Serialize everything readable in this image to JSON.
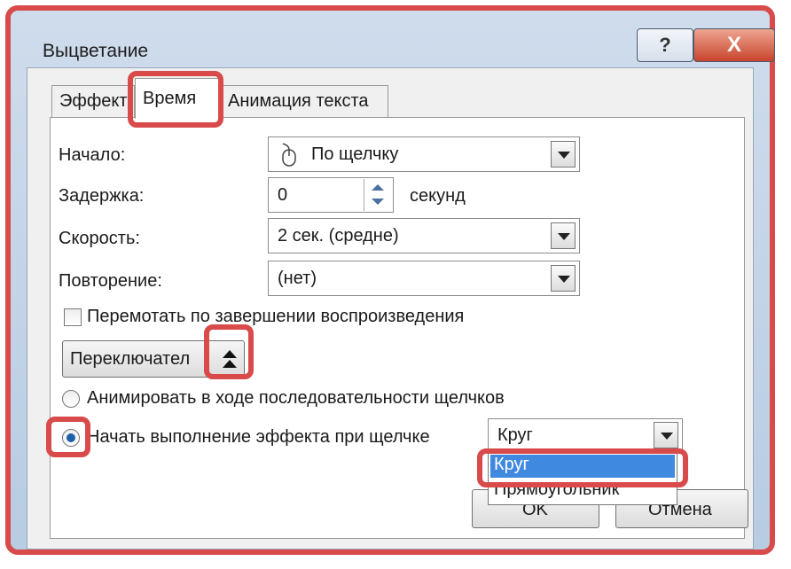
{
  "window": {
    "title": "Выцветание"
  },
  "titlebar": {
    "help_label": "?",
    "close_label": "X"
  },
  "tabs": [
    {
      "label": "Эффект"
    },
    {
      "label": "Время"
    },
    {
      "label": "Анимация текста"
    }
  ],
  "timing": {
    "start_label": "Начало:",
    "start_value": "По щелчку",
    "delay_label": "Задержка:",
    "delay_value": "0",
    "delay_unit": "секунд",
    "speed_label": "Скорость:",
    "speed_value": "2 сек. (средне)",
    "repeat_label": "Повторение:",
    "repeat_value": "(нет)",
    "rewind_label": "Перемотать по завершении воспроизведения",
    "triggers_label": "Переключател",
    "radio_sequence_label": "Анимировать в ходе последовательности щелчков",
    "radio_click_label": "Начать выполнение эффекта при щелчке",
    "shape_value": "Круг",
    "shape_options": [
      "Круг",
      "Прямоугольник"
    ]
  },
  "footer": {
    "ok_label": "OK",
    "cancel_label": "Отмена"
  },
  "colors": {
    "highlight": "#d94a4a",
    "selection": "#3f8ae0"
  }
}
